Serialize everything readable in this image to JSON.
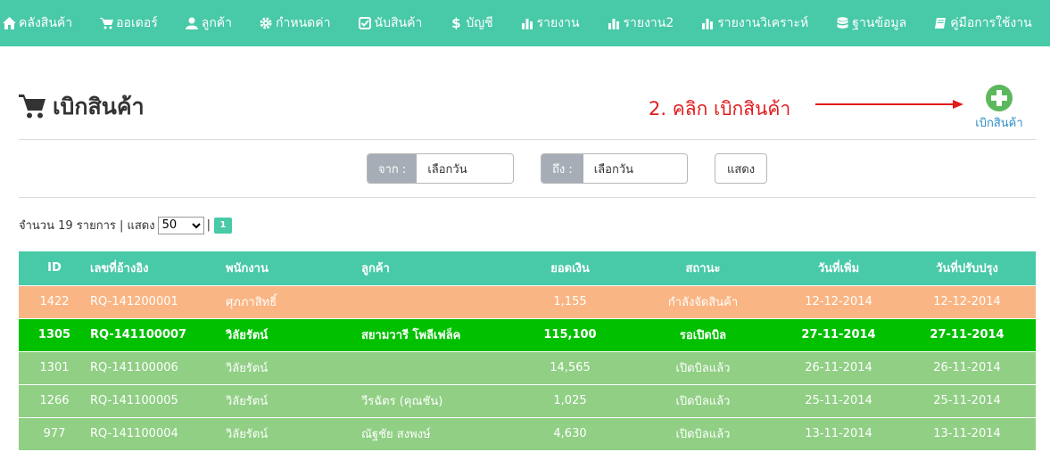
{
  "nav": [
    {
      "label": "คลังสินค้า",
      "icon": "home-icon"
    },
    {
      "label": "ออเดอร์",
      "icon": "cart-icon"
    },
    {
      "label": "ลูกค้า",
      "icon": "user-icon"
    },
    {
      "label": "กำหนดค่า",
      "icon": "gear-icon"
    },
    {
      "label": "นับสินค้า",
      "icon": "check-square-icon"
    },
    {
      "label": "บัญชี",
      "icon": "dollar-icon"
    },
    {
      "label": "รายงาน",
      "icon": "bar-chart-icon"
    },
    {
      "label": "รายงาน2",
      "icon": "bar-chart-icon"
    },
    {
      "label": "รายงานวิเคราะห์",
      "icon": "bar-chart-icon"
    },
    {
      "label": "ฐานข้อมูล",
      "icon": "database-icon"
    },
    {
      "label": "คู่มือการใช้งาน",
      "icon": "book-icon"
    }
  ],
  "page": {
    "title": "เบิกสินค้า",
    "annotation": "2. คลิก เบิกสินค้า",
    "add_button_label": "เบิกสินค้า"
  },
  "filters": {
    "from_label": "จาก :",
    "from_value": "เลือกวัน",
    "to_label": "ถึง :",
    "to_value": "เลือกวัน",
    "show_label": "แสดง"
  },
  "listing": {
    "count_text": "จำนวน 19 รายการ | แสดง",
    "per_page": "50",
    "separator": "|",
    "current_page": "1"
  },
  "table": {
    "headers": [
      "ID",
      "เลขที่อ้างอิง",
      "พนักงาน",
      "ลูกค้า",
      "ยอดเงิน",
      "สถานะ",
      "วันที่เพิ่ม",
      "วันที่ปรับปรุง"
    ],
    "rows": [
      {
        "id": "1422",
        "ref": "RQ-141200001",
        "staff": "ศุภภาสิทธิ์",
        "customer": "",
        "amount": "1,155",
        "status": "กำลังจัดสินค้า",
        "added": "12-12-2014",
        "updated": "12-12-2014"
      },
      {
        "id": "1305",
        "ref": "RQ-141100007",
        "staff": "วิลัยรัตน์",
        "customer": "สยามวารี โพลีเฟล็ค",
        "amount": "115,100",
        "status": "รอเปิดบิล",
        "added": "27-11-2014",
        "updated": "27-11-2014"
      },
      {
        "id": "1301",
        "ref": "RQ-141100006",
        "staff": "วิลัยรัตน์",
        "customer": "",
        "amount": "14,565",
        "status": "เปิดบิลแล้ว",
        "added": "26-11-2014",
        "updated": "26-11-2014"
      },
      {
        "id": "1266",
        "ref": "RQ-141100005",
        "staff": "วิลัยรัตน์",
        "customer": "วีรฉัตร (คุณชัน)",
        "amount": "1,025",
        "status": "เปิดบิลแล้ว",
        "added": "25-11-2014",
        "updated": "25-11-2014"
      },
      {
        "id": "977",
        "ref": "RQ-141100004",
        "staff": "วิลัยรัตน์",
        "customer": "ณัฐชัย สงพงษ์",
        "amount": "4,630",
        "status": "เปิดบิลแล้ว",
        "added": "13-11-2014",
        "updated": "13-11-2014"
      }
    ]
  },
  "colors": {
    "nav_bg": "#48c9a8",
    "row_preparing": "#f9b583",
    "row_waiting": "#00c000",
    "row_billed": "#90cf84",
    "annotation": "#e21b1b",
    "add_icon": "#5cb85c"
  }
}
